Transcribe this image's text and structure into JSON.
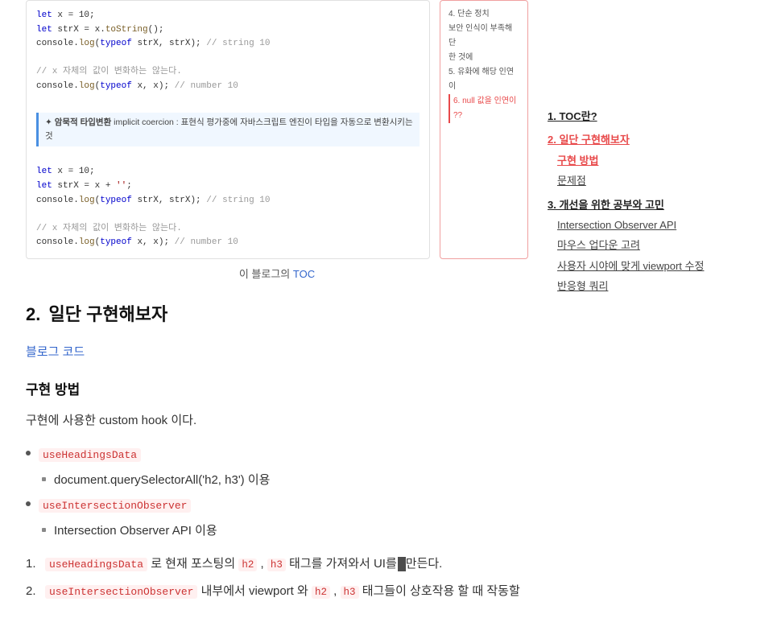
{
  "preview": {
    "caption_text": "이 블로그의",
    "caption_link_text": "TOC",
    "caption_link_href": "#"
  },
  "toc_preview": {
    "items": [
      {
        "text": "4. 단순 정치",
        "active": false
      },
      {
        "text": "보안 인식이 부족해 단",
        "active": false
      },
      {
        "text": "한 것에",
        "active": false
      },
      {
        "text": "5. 유화에 해당 인연이",
        "active": false
      },
      {
        "text": "6. null 값을 인연이 ??",
        "active": true
      }
    ]
  },
  "code_lines": [
    "let x = 10;",
    "let strX = x.toString();",
    "console.log(typeof strX, strX); // string 10",
    "",
    "// x 자체의 값이 변화하는 않는다.",
    "console.log(typeof x, x); // number 10",
    "",
    "note: 암묵적 타입변환 implicit coercion: 표현식 평가중에 자바스크립트 엔진이 타입을 자동으로 변환시키는 것",
    "",
    "let x = 10;",
    "let strX = x + '';",
    "console.log(typeof strX, strX); // string 10",
    "",
    "// x 자체의 값이 변화하는 않는다.",
    "console.log(typeof x, x); // number 10"
  ],
  "section": {
    "number": "2.",
    "title": "일단 구현해보자"
  },
  "blog_link": {
    "text": "블로그 코드"
  },
  "sub_section": {
    "title": "구현 방법"
  },
  "paragraph": {
    "text": "구현에 사용한 custom hook 이다."
  },
  "bullet_items": [
    {
      "id": "item1",
      "code": "useHeadingsData",
      "sub": "document.querySelectorAll('h2, h3') 이용"
    },
    {
      "id": "item2",
      "code": "useIntersectionObserver",
      "sub": "Intersection Observer API 이용"
    }
  ],
  "numbered_items": [
    {
      "num": "1.",
      "prefix_code": "useHeadingsData",
      "prefix_text": " 로 현재 포스팅의 ",
      "tag1": "h2",
      "separator": " , ",
      "tag2": "h3",
      "suffix": " 태그를 가져와서 UI를 만든다."
    },
    {
      "num": "2.",
      "prefix_code": "useIntersectionObserver",
      "prefix_text": " 내부에서 viewport 와 ",
      "tag1": "h2",
      "separator": " , ",
      "tag2": "h3",
      "suffix": " 태그들이 상호작용 할 때 작동할"
    }
  ],
  "sidebar_toc": {
    "entries": [
      {
        "level": "level1",
        "text": "1. TOC란?",
        "active": false
      },
      {
        "level": "level1 active",
        "text": "2. 일단 구현해보자",
        "active": true
      },
      {
        "level": "level2 active-sub",
        "text": "구현 방법",
        "active": true
      },
      {
        "level": "level2",
        "text": "문제점",
        "active": false
      },
      {
        "level": "level1",
        "text": "3. 개선을 위한 공부와 고민",
        "active": false
      },
      {
        "level": "level2",
        "text": "Intersection Observer API",
        "active": false
      },
      {
        "level": "level2",
        "text": "마우스 업다운 고려",
        "active": false
      },
      {
        "level": "level2",
        "text": "사용자 시야에 맞게 viewport 수정",
        "active": false
      },
      {
        "level": "level2",
        "text": "반응형 쿼리",
        "active": false
      }
    ]
  }
}
